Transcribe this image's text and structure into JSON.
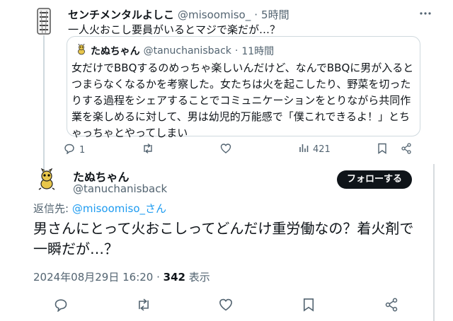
{
  "top_tweet": {
    "display_name": "センチメンタルよしこ",
    "handle": "@misoomiso_",
    "dot": "·",
    "time": "5時間",
    "text": "一人火おこし要員がいるとマジで楽だが…？",
    "more_icon": "more-icon"
  },
  "quoted_tweet": {
    "display_name": "たぬちゃん",
    "handle": "@tanuchanisback",
    "dot": "·",
    "time": "11時間",
    "text": "女だけでBBQするのめっちゃ楽しいんだけど、なんでBBQに男が入るとつまらなくなるかを考察した。女たちは火を起こしたり、野菜を切ったりする過程をシェアすることでコミュニケーションをとりながら共同作業を楽しめるに対して、男は幼児的万能感で「僕これできるよ！」とちゃっちゃとやってしまい"
  },
  "top_actions": {
    "reply_count": "1",
    "views_count": "421",
    "icons": [
      "reply-icon",
      "retweet-icon",
      "like-icon",
      "views-icon",
      "bookmark-icon",
      "share-icon"
    ]
  },
  "main_tweet": {
    "display_name": "たぬちゃん",
    "handle": "@tanuchanisback",
    "follow_label": "フォローする",
    "reply_to_prefix": "返信先: ",
    "reply_to_handle": "@misoomiso_さん",
    "text": "男さんにとって火おこしってどんだけ重労働なの？着火剤で一瞬だが…？",
    "timestamp": "2024年08月29日 16:20",
    "sep": " · ",
    "views_count": "342",
    "views_label": " 表示"
  },
  "colors": {
    "text": "#0f1419",
    "muted": "#536471",
    "link": "#1d9bf0",
    "border": "#cfd9de",
    "follow_bg": "#0f1419"
  }
}
